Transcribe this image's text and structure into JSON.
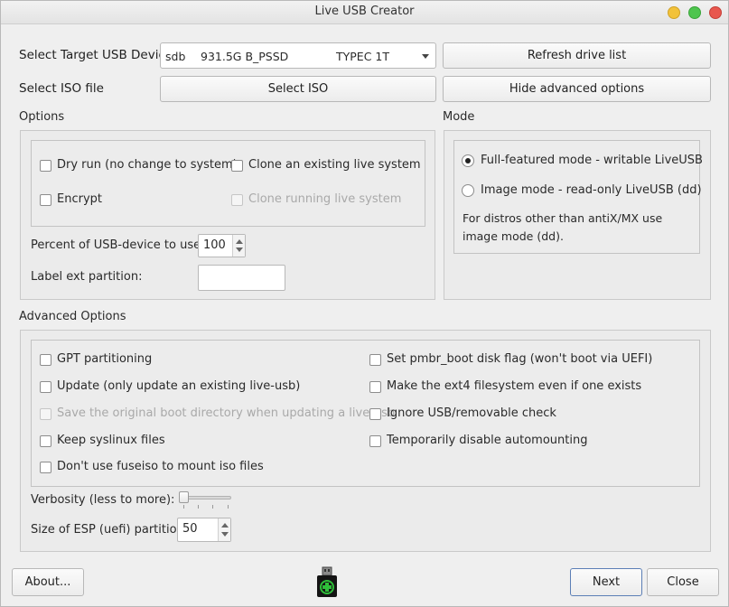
{
  "window": {
    "title": "Live USB Creator"
  },
  "target": {
    "label": "Select Target USB Device",
    "device": "sdb",
    "size": "931.5G B_PSSD",
    "model": "TYPEC 1T",
    "refresh_label": "Refresh drive list"
  },
  "iso": {
    "label": "Select ISO file",
    "select_label": "Select ISO",
    "hide_advanced_label": "Hide advanced options"
  },
  "options": {
    "heading": "Options",
    "dry_run": "Dry run (no change to system)",
    "clone_existing": "Clone an existing live system",
    "encrypt": "Encrypt",
    "clone_running": "Clone running live system",
    "percent_label": "Percent of USB-device to use:",
    "percent_value": "100",
    "label_ext_label": "Label ext partition:",
    "label_ext_value": ""
  },
  "mode": {
    "heading": "Mode",
    "full_featured": "Full-featured mode - writable LiveUSB",
    "image_mode": "Image mode - read-only LiveUSB (dd)",
    "note": "For distros other than antiX/MX use image mode (dd)."
  },
  "advanced": {
    "heading": "Advanced Options",
    "gpt": "GPT partitioning",
    "update": "Update (only update an existing live-usb)",
    "save_boot": "Save the original boot directory when updating a live-usb",
    "keep_syslinux": "Keep syslinux files",
    "no_fuseiso": "Don't use fuseiso to mount iso files",
    "pmbr": "Set pmbr_boot disk flag (won't boot via UEFI)",
    "force_ext4": "Make the ext4 filesystem even if one exists",
    "ignore_usb": "Ignore USB/removable check",
    "disable_automount": "Temporarily disable automounting",
    "verbosity_label": "Verbosity (less to more):",
    "verbosity_level": 0,
    "esp_label": "Size of ESP (uefi) partition:",
    "esp_value": "50"
  },
  "footer": {
    "about_label": "About...",
    "next_label": "Next",
    "close_label": "Close",
    "logo_icon": "usb-stick-plus-icon"
  },
  "colors": {
    "close": "#f2c23a",
    "maximize": "#4ec54e",
    "minimize": "#e8574e",
    "logo_green": "#2fbf3a"
  }
}
